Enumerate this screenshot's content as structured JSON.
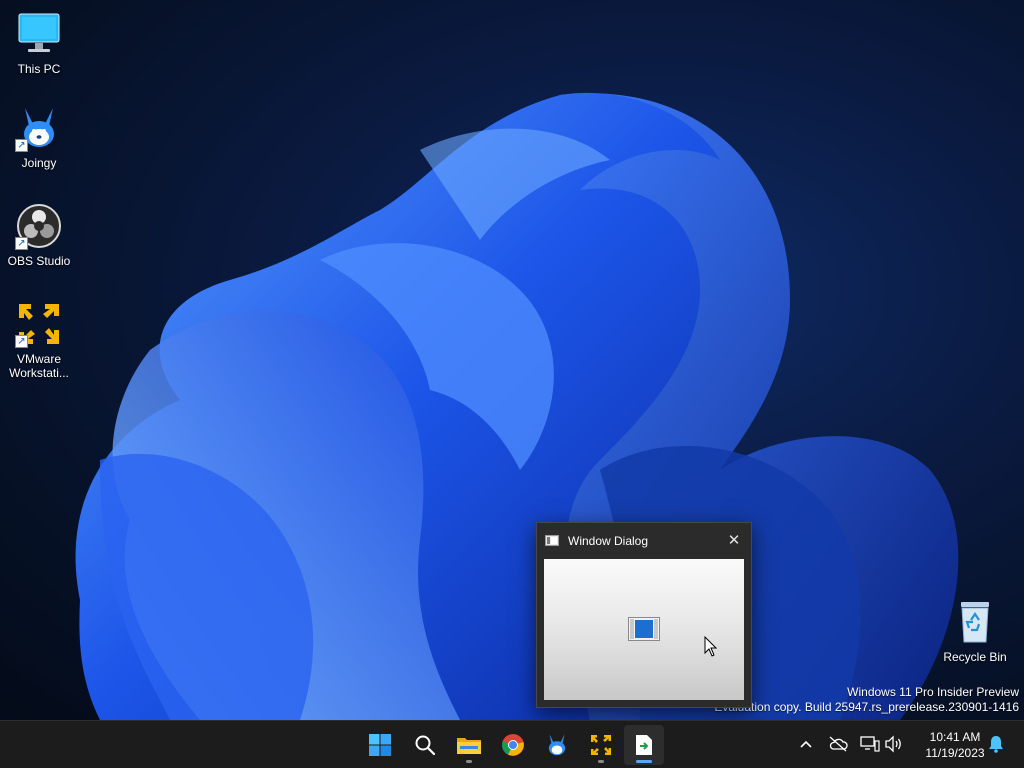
{
  "desktop_icons": [
    {
      "name": "this-pc",
      "label": "This PC",
      "icon": "monitor-icon",
      "shortcut": false
    },
    {
      "name": "joingy",
      "label": "Joingy",
      "icon": "rabbit-icon",
      "shortcut": true
    },
    {
      "name": "obs-studio",
      "label": "OBS Studio",
      "icon": "obs-icon",
      "shortcut": true
    },
    {
      "name": "vmware",
      "label": "VMware Workstati...",
      "icon": "vmware-icon",
      "shortcut": true
    },
    {
      "name": "recycle-bin",
      "label": "Recycle Bin",
      "icon": "recycle-bin-icon",
      "shortcut": false
    }
  ],
  "watermark": {
    "line1": "Windows 11 Pro Insider Preview",
    "line2": "Evaluation copy. Build 25947.rs_prerelease.230901-1416"
  },
  "dialog": {
    "title": "Window Dialog",
    "close_symbol": "✕"
  },
  "taskbar": {
    "apps": [
      "start-icon",
      "search-icon",
      "file-explorer-icon",
      "chrome-icon",
      "joingy-icon",
      "vmware-icon",
      "app-window-icon"
    ],
    "active_app": "app-window-icon",
    "tray": {
      "chevron_symbol": "^",
      "icons": [
        "chevron-up-icon",
        "onedrive-offline-icon",
        "network-icon",
        "volume-icon"
      ],
      "time": "10:41 AM",
      "date": "11/19/2023",
      "notification_icon": "bell-icon"
    }
  },
  "colors": {
    "accent": "#1a6fe6",
    "taskbar": "#1c1c1c",
    "dialog_frame": "#2b2b2b",
    "active_indicator": "#5aa9f7"
  }
}
